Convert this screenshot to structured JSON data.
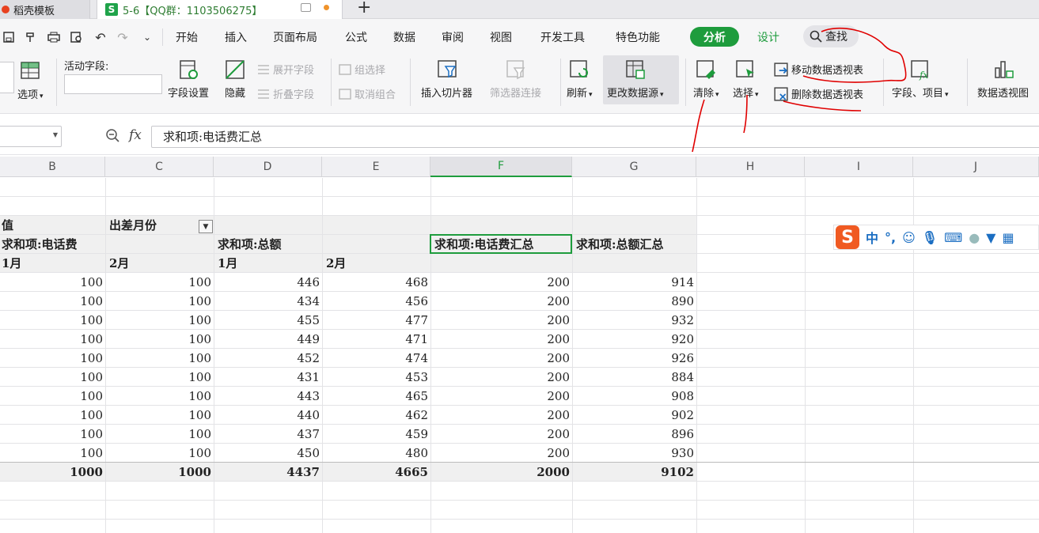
{
  "tabs": [
    {
      "label": "稻壳模板"
    },
    {
      "label": "5-6【QQ群：1103506275】"
    }
  ],
  "menu": {
    "items": [
      "开始",
      "插入",
      "页面布局",
      "公式",
      "数据",
      "审阅",
      "视图",
      "开发工具",
      "特色功能"
    ],
    "analyze": "分析",
    "design": "设计",
    "search": "查找"
  },
  "ribbon": {
    "select_left": "选项",
    "active_field_label": "活动字段:",
    "field_settings": "字段设置",
    "hide": "隐藏",
    "expand_field": "展开字段",
    "collapse_field": "折叠字段",
    "group_select": "组选择",
    "ungroup": "取消组合",
    "insert_slicer": "插入切片器",
    "filter_conn": "筛选器连接",
    "refresh": "刷新",
    "change_source": "更改数据源",
    "clear": "清除",
    "select": "选择",
    "move_pivot": "移动数据透视表",
    "delete_pivot": "删除数据透视表",
    "fields_items": "字段、项目",
    "pivot_chart": "数据透视图"
  },
  "formula_bar": {
    "fx": "fx",
    "content": "求和项:电话费汇总"
  },
  "columns": [
    "B",
    "C",
    "D",
    "E",
    "F",
    "G",
    "H",
    "I",
    "J"
  ],
  "pivot": {
    "r1": {
      "values": "值",
      "month_field": "出差月份"
    },
    "r2": {
      "phone": "求和项:电话费",
      "amount": "求和项:总额",
      "phone_total": "求和项:电话费汇总",
      "amount_total": "求和项:总额汇总"
    },
    "r3": {
      "b": "1月",
      "c": "2月",
      "d": "1月",
      "e": "2月"
    },
    "rows": [
      [
        "100",
        "100",
        "446",
        "468",
        "200",
        "914"
      ],
      [
        "100",
        "100",
        "434",
        "456",
        "200",
        "890"
      ],
      [
        "100",
        "100",
        "455",
        "477",
        "200",
        "932"
      ],
      [
        "100",
        "100",
        "449",
        "471",
        "200",
        "920"
      ],
      [
        "100",
        "100",
        "452",
        "474",
        "200",
        "926"
      ],
      [
        "100",
        "100",
        "431",
        "453",
        "200",
        "884"
      ],
      [
        "100",
        "100",
        "443",
        "465",
        "200",
        "908"
      ],
      [
        "100",
        "100",
        "440",
        "462",
        "200",
        "902"
      ],
      [
        "100",
        "100",
        "437",
        "459",
        "200",
        "896"
      ],
      [
        "100",
        "100",
        "450",
        "480",
        "200",
        "930"
      ]
    ],
    "total": [
      "1000",
      "1000",
      "4437",
      "4665",
      "2000",
      "9102"
    ]
  },
  "ime": {
    "logo": "S",
    "lang": "中",
    "punct": "°,"
  },
  "colors": {
    "accent": "#1e9c3d",
    "annotation": "#e00000"
  }
}
